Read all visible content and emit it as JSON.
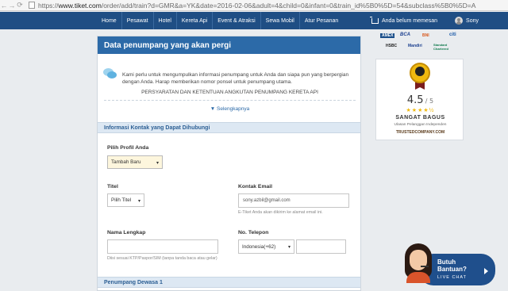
{
  "browser": {
    "url_prefix": "https://",
    "url_host": "www.tiket.com",
    "url_path": "/order/add/train?d=GMR&a=YK&date=2016-02-06&adult=4&child=0&infant=0&train_id%5B0%5D=54&subclass%5B0%5D=A"
  },
  "nav": {
    "items": [
      "Home",
      "Pesawat",
      "Hotel",
      "Kereta Api",
      "Event & Atraksi",
      "Sewa Mobil",
      "Atur Pesanan"
    ],
    "cart_label": "Anda belum memesan",
    "user_name": "Sony"
  },
  "form": {
    "title": "Data penumpang yang akan pergi",
    "info_text": "Kami perlu untuk mengumpulkan informasi penumpang untuk Anda dan siapa pun yang berpergian dengan Anda. Harap memberikan nomor ponsel untuk penumpang utama.",
    "terms": "PERSYARATAN DAN KETENTUAN ANGKUTAN PENUMPANG KERETA API",
    "more_link": "▼ Selengkapnya",
    "contact_section": "Informasi Kontak yang Dapat Dihubungi",
    "profile_label": "Pilih Profil Anda",
    "profile_value": "Tambah Baru",
    "title_label": "Titel",
    "title_value": "Pilih Titel",
    "email_label": "Kontak Email",
    "email_value": "sony.azbil@gmail.com",
    "email_hint": "E-Tiket Anda akan dikirim ke alamat email ini.",
    "name_label": "Nama Lengkap",
    "name_value": "",
    "name_hint": "Diisi sesuai KTP/Paspor/SIM (tanpa tanda baca atau gelar)",
    "phone_label": "No. Telepon",
    "phone_code": "Indonesia(+62)",
    "phone_value": "",
    "passenger_section": "Penumpang Dewasa 1"
  },
  "sidebar": {
    "banks": [
      "AMEX",
      "BCA",
      "BNI",
      "citi",
      "HSBC",
      "Mandiri",
      "Standard Chartered"
    ],
    "rating_value": "4.5",
    "rating_max": "/ 5",
    "stars": "★★★★½",
    "verdict": "SANGAT BAGUS",
    "verdict_sub": "Ulasan Pelanggan Independen",
    "trusted": "TRUSTEDCOMPANY.COM"
  },
  "help": {
    "title": "Butuh Bantuan?",
    "subtitle": "LIVE CHAT"
  }
}
